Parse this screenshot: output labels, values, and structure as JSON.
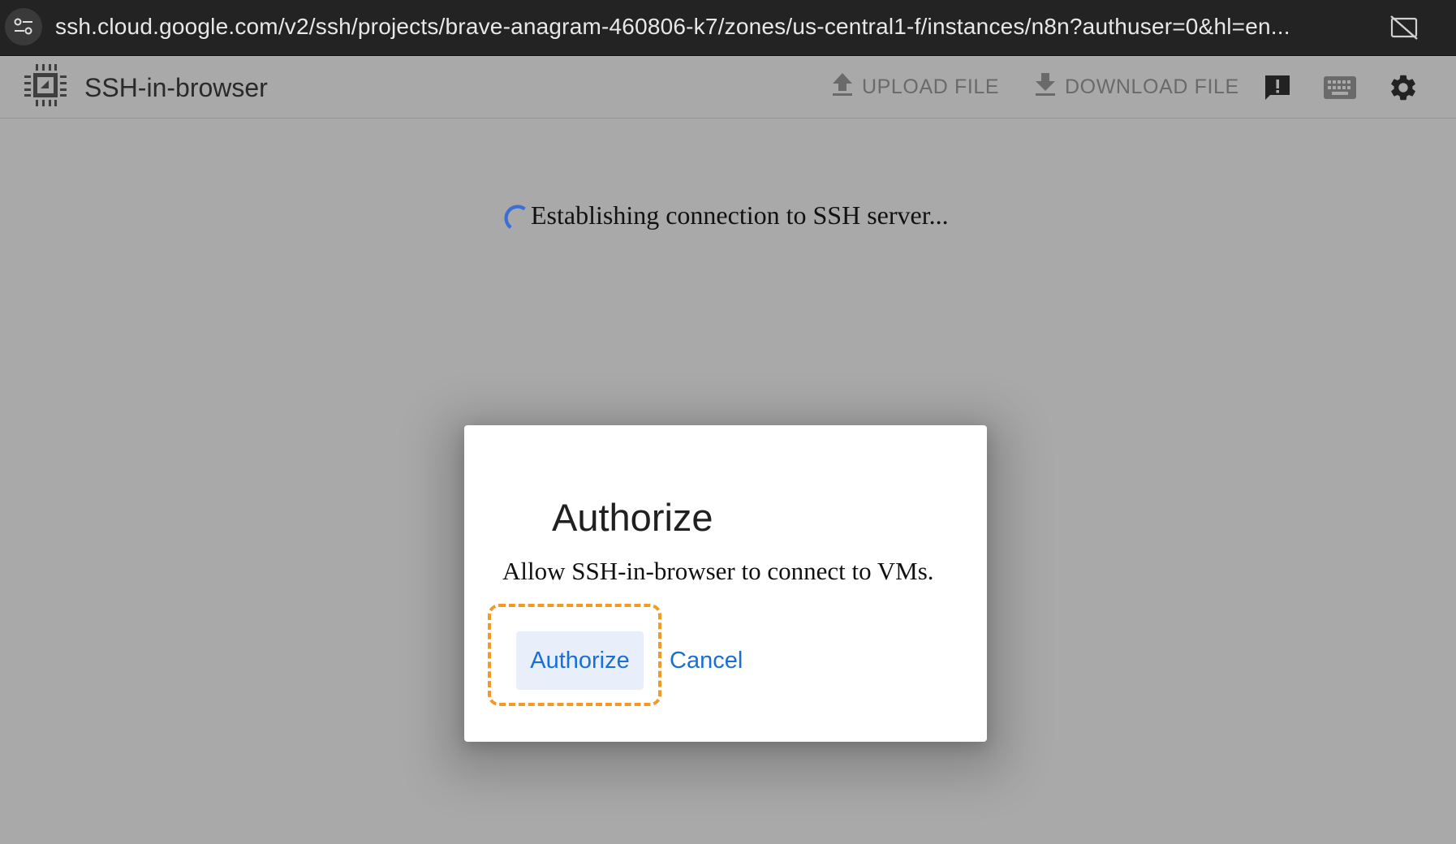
{
  "browser": {
    "url": "ssh.cloud.google.com/v2/ssh/projects/brave-anagram-460806-k7/zones/us-central1-f/instances/n8n?authuser=0&hl=en...",
    "site_info_icon": "tune-icon",
    "cast_icon": "cast-off-icon"
  },
  "app": {
    "title": "SSH-in-browser",
    "logo_icon": "chip-icon",
    "toolbar": {
      "upload_label": "UPLOAD FILE",
      "download_label": "DOWNLOAD FILE",
      "feedback_icon": "feedback-icon",
      "keyboard_icon": "keyboard-icon",
      "settings_icon": "gear-icon"
    }
  },
  "status": {
    "text": "Establishing connection to SSH server..."
  },
  "dialog": {
    "title": "Authorize",
    "message": "Allow SSH-in-browser to connect to VMs.",
    "authorize_label": "Authorize",
    "cancel_label": "Cancel"
  },
  "colors": {
    "accent": "#1a6fd6",
    "highlight": "#f29a24",
    "overlay": "#a9a9a9",
    "spinner": "#3b6fd4"
  }
}
